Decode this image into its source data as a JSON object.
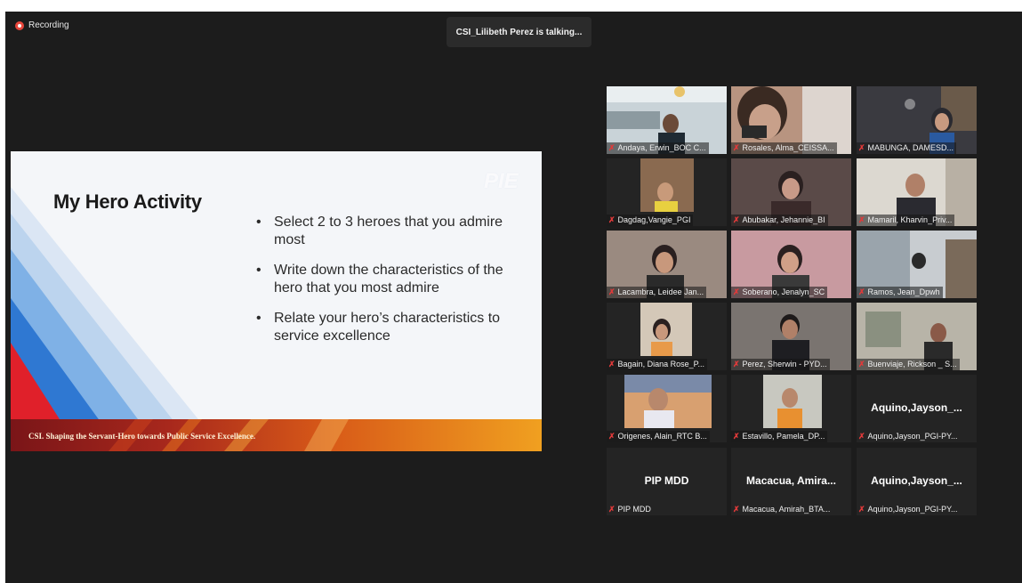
{
  "recording": {
    "label": "Recording"
  },
  "talking": {
    "text": "CSI_Lilibeth Perez is talking..."
  },
  "slide": {
    "title": "My Hero Activity",
    "bullets": [
      "Select 2 to 3 heroes that you admire most",
      "Write down the characteristics of the hero that you most admire",
      "Relate your hero’s characteristics to service excellence"
    ],
    "watermark": "PIE",
    "footer": "CSI. Shaping the Servant-Hero towards Public Service Excellence."
  },
  "participants": [
    {
      "name": "Andaya, Erwin_BOC C...",
      "video": true
    },
    {
      "name": "Rosales, Alma_CEISSA...",
      "video": true
    },
    {
      "name": "MABUNGA, DAMESD...",
      "video": true
    },
    {
      "name": "Dagdag,Vangie_PGI",
      "video": true
    },
    {
      "name": "Abubakar, Jehannie_BI",
      "video": true
    },
    {
      "name": "Mamaril, Kharvin_Priv...",
      "video": true
    },
    {
      "name": "Lacambra, Leidee Jan...",
      "video": true
    },
    {
      "name": "Soberano, Jenalyn_SC",
      "video": true
    },
    {
      "name": "Ramos, Jean_Dpwh",
      "video": true
    },
    {
      "name": "Bagain, Diana Rose_P...",
      "video": true
    },
    {
      "name": "Perez, Sherwin - PYD...",
      "video": true
    },
    {
      "name": "Buenviaje, Rickson _ S...",
      "video": true
    },
    {
      "name": "Origenes, Alain_RTC B...",
      "video": true
    },
    {
      "name": "Estavillo, Pamela_DP...",
      "video": true
    },
    {
      "name": "Aquino,Jayson_PGI-PY...",
      "video": false,
      "display": "Aquino,Jayson_..."
    },
    {
      "name": "PIP MDD",
      "video": false,
      "display": "PIP MDD"
    },
    {
      "name": "Macacua, Amirah_BTA...",
      "video": false,
      "display": "Macacua,  Amira..."
    },
    {
      "name": "Aquino,Jayson_PGI-PY...",
      "video": false,
      "display": "Aquino,Jayson_..."
    }
  ],
  "colors": {
    "muted_mic": "#e03a3a",
    "background": "#1c1c1c",
    "tile": "#242424"
  },
  "icons": {
    "mic": "muted-mic-icon",
    "record": "record-dot-icon"
  }
}
